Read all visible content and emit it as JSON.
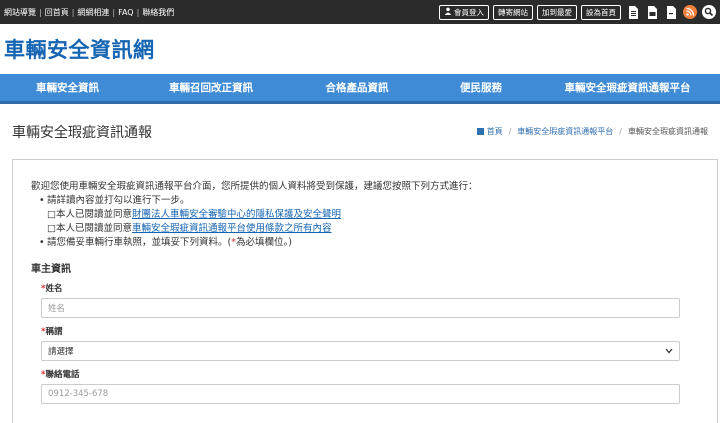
{
  "topbar": {
    "links": [
      "網站導覽",
      "回首頁",
      "網網相連",
      "FAQ",
      "聯絡我們"
    ],
    "buttons": {
      "login": "會員登入",
      "share": "轉寄網站",
      "favorite": "加到最愛",
      "homepage": "設為首頁"
    },
    "icons": [
      "print-icon",
      "document-icon",
      "file-icon",
      "rss-icon",
      "search-icon"
    ]
  },
  "logo": {
    "text": "車輛安全資訊網"
  },
  "nav": {
    "items": [
      "車輛安全資訊",
      "車輛召回改正資訊",
      "合格產品資訊",
      "便民服務",
      "車輛安全瑕疵資訊通報平台"
    ]
  },
  "page": {
    "title": "車輛安全瑕疵資訊通報",
    "breadcrumb": [
      "首頁",
      "車輛安全瑕疵資訊通報平台",
      "車輛安全瑕疵資訊通報"
    ]
  },
  "content": {
    "intro": "歡迎您使用車輛安全瑕疵資訊通報平台介面，您所提供的個人資料將受到保護，建議您按照下列方式進行：",
    "bullet1": "請詳讀內容並打勾以進行下一步。",
    "check1_prefix": "□本人已閱讀並同意",
    "check1_link": "財團法人車輛安全審驗中心的隱私保護及安全聲明",
    "check2_prefix": "□本人已閱讀並同意",
    "check2_link": "車輛安全瑕疵資訊通報平台使用條款之所有內容",
    "bullet2_prefix": "請您備妥車輛行車執照，並填妥下列資料。(",
    "bullet2_star": "*",
    "bullet2_suffix": "為必填欄位。)"
  },
  "owner_section": {
    "title": "車主資訊",
    "fields": {
      "name": {
        "star": "*",
        "label": "姓名",
        "placeholder": "姓名"
      },
      "title": {
        "star": "*",
        "label": "稱謂",
        "selected": "請選擇"
      },
      "phone": {
        "star": "*",
        "label": "聯絡電話",
        "placeholder": "0912-345-678"
      }
    }
  },
  "colors": {
    "topbar": "#2b2b2b",
    "brand": "#1565b3",
    "nav": "#3f8bd6",
    "required": "#dd3333",
    "rss": "#f0803c"
  }
}
